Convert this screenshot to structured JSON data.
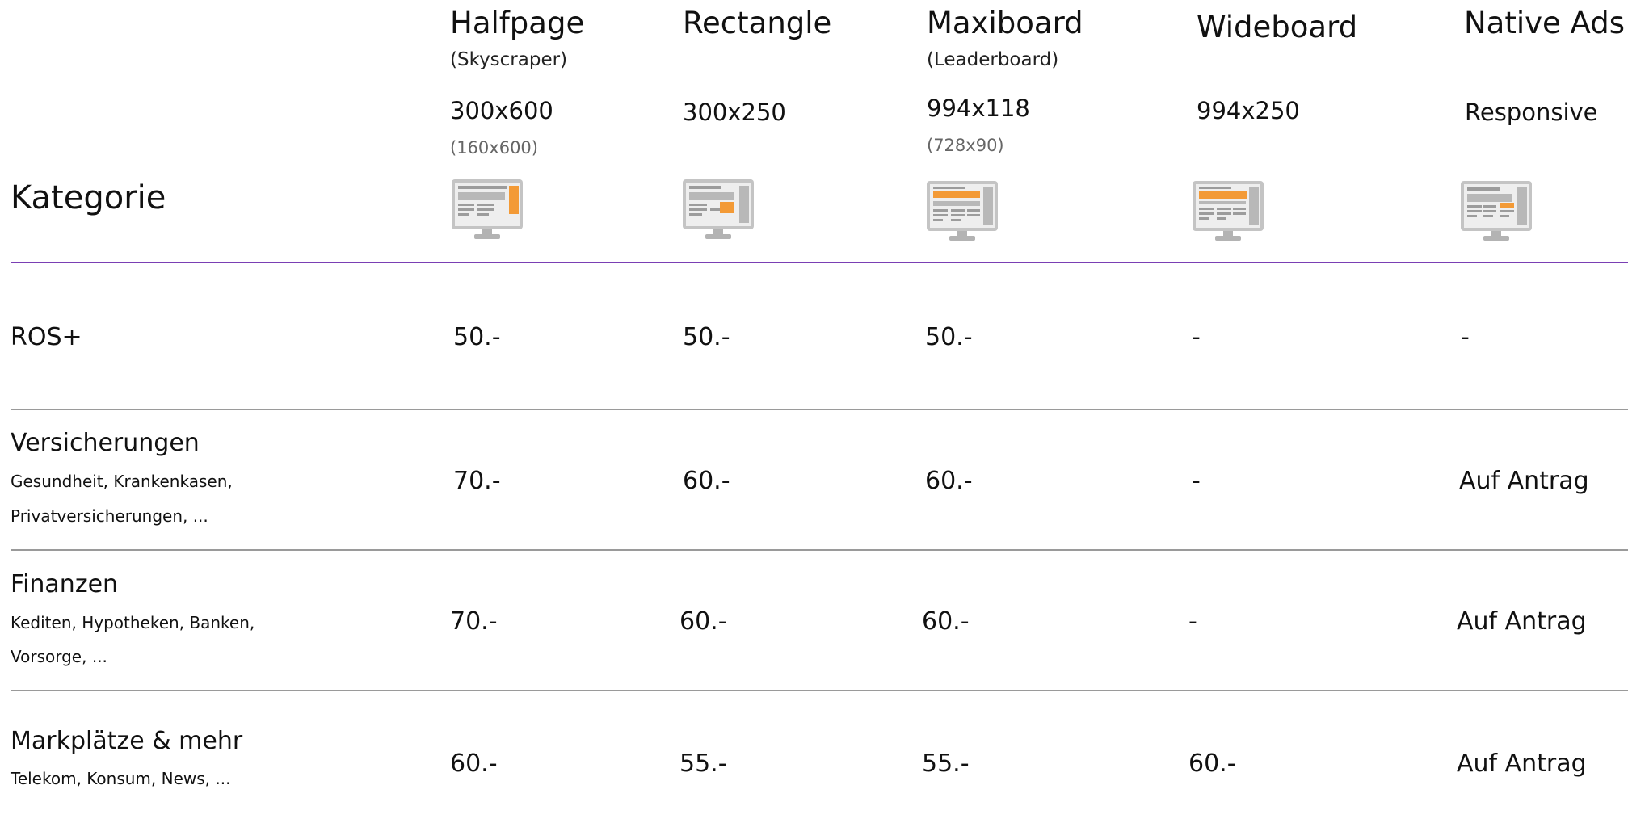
{
  "header": {
    "kategorie_label": "Kategorie"
  },
  "columns": [
    {
      "title": "Halfpage",
      "subtitle": "(Skyscraper)",
      "size": "300x600",
      "alt_size": "(160x600)",
      "icon": "monitor-halfpage-icon"
    },
    {
      "title": "Rectangle",
      "subtitle": "",
      "size": "300x250",
      "alt_size": "",
      "icon": "monitor-rectangle-icon"
    },
    {
      "title": "Maxiboard",
      "subtitle": "(Leaderboard)",
      "size": "994x118",
      "alt_size": "(728x90)",
      "icon": "monitor-maxiboard-icon"
    },
    {
      "title": "Wideboard",
      "subtitle": "",
      "size": "994x250",
      "alt_size": "",
      "icon": "monitor-wideboard-icon"
    },
    {
      "title": "Native Ads",
      "subtitle": "",
      "size": "Responsive",
      "alt_size": "",
      "icon": "monitor-native-icon"
    }
  ],
  "rows": [
    {
      "title": "ROS+",
      "desc_line1": "",
      "desc_line2": "",
      "prices": [
        "50.-",
        "50.-",
        "50.-",
        "-",
        "-"
      ]
    },
    {
      "title": "Versicherungen",
      "desc_line1": "Gesundheit, Krankenkasen,",
      "desc_line2": "Privatversicherungen, ...",
      "prices": [
        "70.-",
        "60.-",
        "60.-",
        "-",
        "Auf Antrag"
      ]
    },
    {
      "title": "Finanzen",
      "desc_line1": "Kediten, Hypotheken, Banken,",
      "desc_line2": "Vorsorge, ...",
      "prices": [
        "70.-",
        "60.-",
        "60.-",
        "-",
        "Auf Antrag"
      ]
    },
    {
      "title": "Markplätze & mehr",
      "desc_line1": "Telekom, Konsum, News, ...",
      "desc_line2": "",
      "prices": [
        "60.-",
        "55.-",
        "55.-",
        "60.-",
        "Auf Antrag"
      ]
    }
  ],
  "colors": {
    "accent_orange": "#f39a36",
    "rule_purple": "#7a3fb4",
    "rule_gray": "#9a9a9a",
    "monitor_gray": "#b3b3b3"
  }
}
